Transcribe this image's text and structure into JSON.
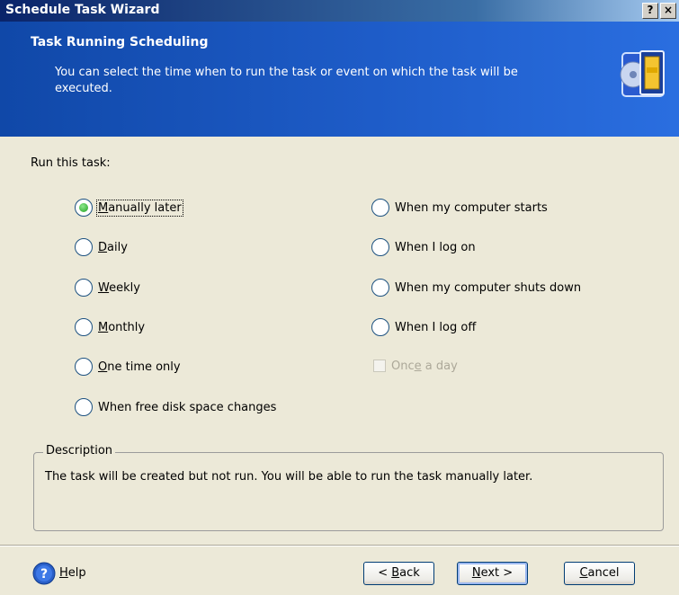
{
  "window": {
    "title": "Schedule Task Wizard",
    "help_button": "?",
    "close_button": "×"
  },
  "header": {
    "title": "Task Running Scheduling",
    "subtitle": "You can select the time when to run the task or event on which the task will be executed."
  },
  "run_label": "Run this task:",
  "options_left": [
    {
      "pre": "",
      "key": "M",
      "post": "anually later",
      "selected": true
    },
    {
      "pre": "",
      "key": "D",
      "post": "aily",
      "selected": false
    },
    {
      "pre": "",
      "key": "W",
      "post": "eekly",
      "selected": false
    },
    {
      "pre": "",
      "key": "M",
      "post": "onthly",
      "selected": false
    },
    {
      "pre": "",
      "key": "O",
      "post": "ne time only",
      "selected": false
    },
    {
      "pre": "When free disk space changes",
      "key": "",
      "post": "",
      "selected": false
    }
  ],
  "options_right": [
    {
      "label": "When my computer starts",
      "selected": false
    },
    {
      "label": "When I log on",
      "selected": false
    },
    {
      "label": "When my computer shuts down",
      "selected": false
    },
    {
      "label": "When I log off",
      "selected": false
    }
  ],
  "once_a_day": {
    "pre": "Onc",
    "key": "e",
    "post": " a day",
    "checked": false,
    "enabled": false
  },
  "description": {
    "legend": "Description",
    "text": "The task will be created but not run. You will be able to run the task manually later."
  },
  "footer": {
    "help": {
      "key": "H",
      "post": "elp"
    },
    "back": {
      "pre": "< ",
      "key": "B",
      "post": "ack"
    },
    "next": {
      "key": "N",
      "post": "ext >"
    },
    "cancel": {
      "key": "C",
      "post": "ancel"
    }
  },
  "colors": {
    "header_blue": "#1e5cc8",
    "radio_selected": "#21a121"
  }
}
